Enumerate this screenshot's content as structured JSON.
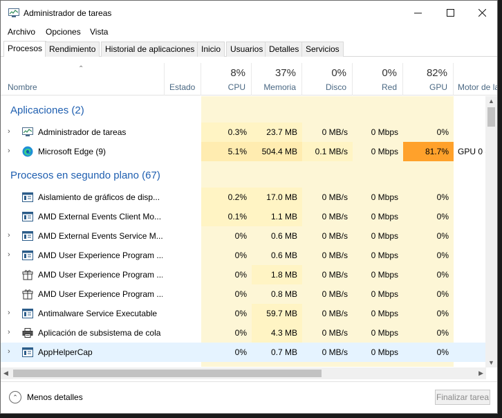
{
  "window": {
    "title": "Administrador de tareas"
  },
  "menu": [
    "Archivo",
    "Opciones",
    "Vista"
  ],
  "tabs": [
    "Procesos",
    "Rendimiento",
    "Historial de aplicaciones",
    "Inicio",
    "Usuarios",
    "Detalles",
    "Servicios"
  ],
  "header": {
    "name": "Nombre",
    "status": "Estado",
    "cpu": {
      "pct": "8%",
      "label": "CPU"
    },
    "memory": {
      "pct": "37%",
      "label": "Memoria"
    },
    "disk": {
      "pct": "0%",
      "label": "Disco"
    },
    "network": {
      "pct": "0%",
      "label": "Red"
    },
    "gpu": {
      "pct": "82%",
      "label": "GPU"
    },
    "gpu_engine": "Motor de la"
  },
  "groups": {
    "apps": "Aplicaciones (2)",
    "background": "Procesos en segundo plano (67)"
  },
  "apps": [
    {
      "name": "Administrador de tareas",
      "cpu": "0.3%",
      "mem": "23.7 MB",
      "disk": "0 MB/s",
      "net": "0 Mbps",
      "gpu": "0%",
      "engine": "",
      "icon": "task-manager-icon"
    },
    {
      "name": "Microsoft Edge (9)",
      "cpu": "5.1%",
      "mem": "504.4 MB",
      "disk": "0.1 MB/s",
      "net": "0 Mbps",
      "gpu": "81.7%",
      "engine": "GPU 0 -",
      "icon": "edge-icon"
    }
  ],
  "background": [
    {
      "name": "Aislamiento de gráficos de disp...",
      "cpu": "0.2%",
      "mem": "17.0 MB",
      "disk": "0 MB/s",
      "net": "0 Mbps",
      "gpu": "0%",
      "expander": false,
      "icon": "window-icon"
    },
    {
      "name": "AMD External Events Client Mo...",
      "cpu": "0.1%",
      "mem": "1.1 MB",
      "disk": "0 MB/s",
      "net": "0 Mbps",
      "gpu": "0%",
      "expander": false,
      "icon": "window-icon"
    },
    {
      "name": "AMD External Events Service M...",
      "cpu": "0%",
      "mem": "0.6 MB",
      "disk": "0 MB/s",
      "net": "0 Mbps",
      "gpu": "0%",
      "expander": true,
      "icon": "window-icon"
    },
    {
      "name": "AMD User Experience Program ...",
      "cpu": "0%",
      "mem": "0.6 MB",
      "disk": "0 MB/s",
      "net": "0 Mbps",
      "gpu": "0%",
      "expander": true,
      "icon": "window-icon"
    },
    {
      "name": "AMD User Experience Program ...",
      "cpu": "0%",
      "mem": "1.8 MB",
      "disk": "0 MB/s",
      "net": "0 Mbps",
      "gpu": "0%",
      "expander": false,
      "icon": "gift-icon"
    },
    {
      "name": "AMD User Experience Program ...",
      "cpu": "0%",
      "mem": "0.8 MB",
      "disk": "0 MB/s",
      "net": "0 Mbps",
      "gpu": "0%",
      "expander": false,
      "icon": "gift-icon"
    },
    {
      "name": "Antimalware Service Executable",
      "cpu": "0%",
      "mem": "59.7 MB",
      "disk": "0 MB/s",
      "net": "0 Mbps",
      "gpu": "0%",
      "expander": true,
      "icon": "window-icon"
    },
    {
      "name": "Aplicación de subsistema de cola",
      "cpu": "0%",
      "mem": "4.3 MB",
      "disk": "0 MB/s",
      "net": "0 Mbps",
      "gpu": "0%",
      "expander": true,
      "icon": "printer-icon"
    },
    {
      "name": "AppHelperCap",
      "cpu": "0%",
      "mem": "0.7 MB",
      "disk": "0 MB/s",
      "net": "0 Mbps",
      "gpu": "0%",
      "expander": true,
      "icon": "window-icon"
    }
  ],
  "footer": {
    "less_details": "Menos detalles",
    "end_task": "Finalizar tarea"
  }
}
